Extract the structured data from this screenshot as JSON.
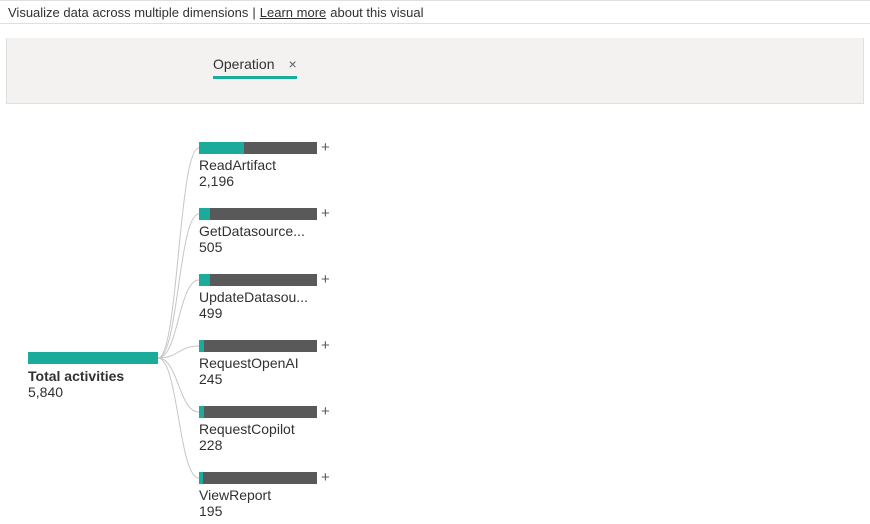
{
  "header": {
    "title_prefix": "Visualize data across multiple dimensions",
    "separator": " | ",
    "link_text": "Learn more",
    "link_suffix": " about this visual"
  },
  "column": {
    "label": "Operation",
    "close_glyph": "×"
  },
  "root": {
    "label": "Total activities",
    "value": "5,840"
  },
  "children": [
    {
      "label": "ReadArtifact",
      "value": "2,196",
      "num": 2196
    },
    {
      "label": "GetDatasource...",
      "value": "505",
      "num": 505
    },
    {
      "label": "UpdateDatasou...",
      "value": "499",
      "num": 499
    },
    {
      "label": "RequestOpenAI",
      "value": "245",
      "num": 245
    },
    {
      "label": "RequestCopilot",
      "value": "228",
      "num": 228
    },
    {
      "label": "ViewReport",
      "value": "195",
      "num": 195
    }
  ],
  "plus_glyph": "+",
  "colors": {
    "accent": "#1aab9b",
    "bar_bg": "#595959"
  },
  "chart_data": {
    "type": "bar",
    "title": "Total activities by Operation",
    "categories": [
      "ReadArtifact",
      "GetDatasource...",
      "UpdateDatasou...",
      "RequestOpenAI",
      "RequestCopilot",
      "ViewReport"
    ],
    "values": [
      2196,
      505,
      499,
      245,
      228,
      195
    ],
    "total": 5840,
    "xlabel": "Operation",
    "ylabel": "Activities"
  }
}
